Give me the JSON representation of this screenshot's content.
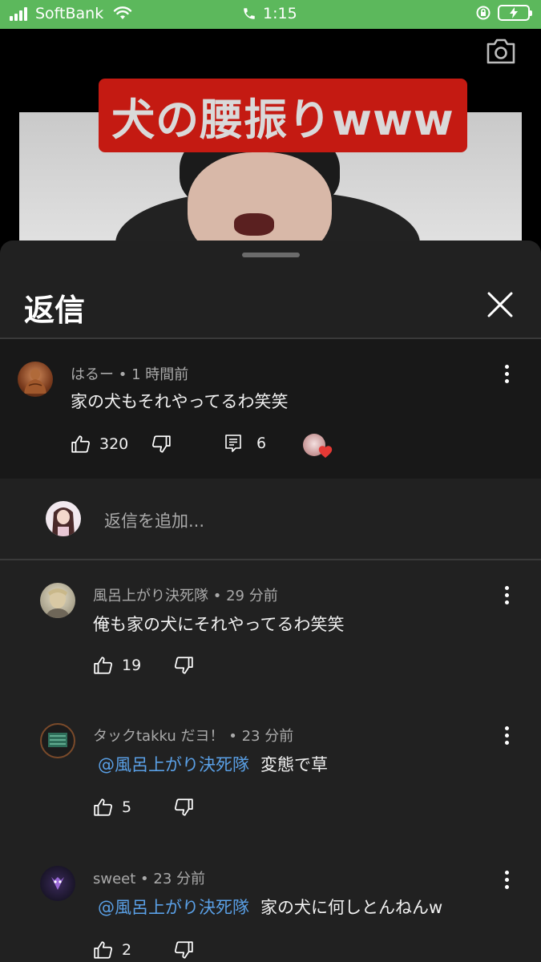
{
  "status_bar": {
    "carrier": "SoftBank",
    "time": "1:15"
  },
  "video": {
    "caption": "犬の腰振りwww"
  },
  "sheet": {
    "title": "返信"
  },
  "parent_comment": {
    "author": "はるー",
    "time": "1 時間前",
    "text": "家の犬もそれやってるわ笑笑",
    "likes": "320",
    "replies": "6"
  },
  "add_reply": {
    "placeholder": "返信を追加..."
  },
  "replies": [
    {
      "author": "風呂上がり決死隊",
      "time": "29 分前",
      "mention": "",
      "text": "俺も家の犬にそれやってるわ笑笑",
      "likes": "19"
    },
    {
      "author": "タックtakku だヨ！",
      "time": "23 分前",
      "mention": "@風呂上がり決死隊",
      "text": "変態で草",
      "likes": "5"
    },
    {
      "author": "sweet",
      "time": "23 分前",
      "mention": "@風呂上がり決死隊",
      "text": "家の犬に何しとんねんw",
      "likes": "2"
    }
  ],
  "separator": "•",
  "colors": {
    "status_bar": "#5cb85c",
    "sheet_bg": "#212121",
    "parent_bg": "#181818",
    "mention": "#5aa0e6",
    "heart": "#e53935"
  }
}
